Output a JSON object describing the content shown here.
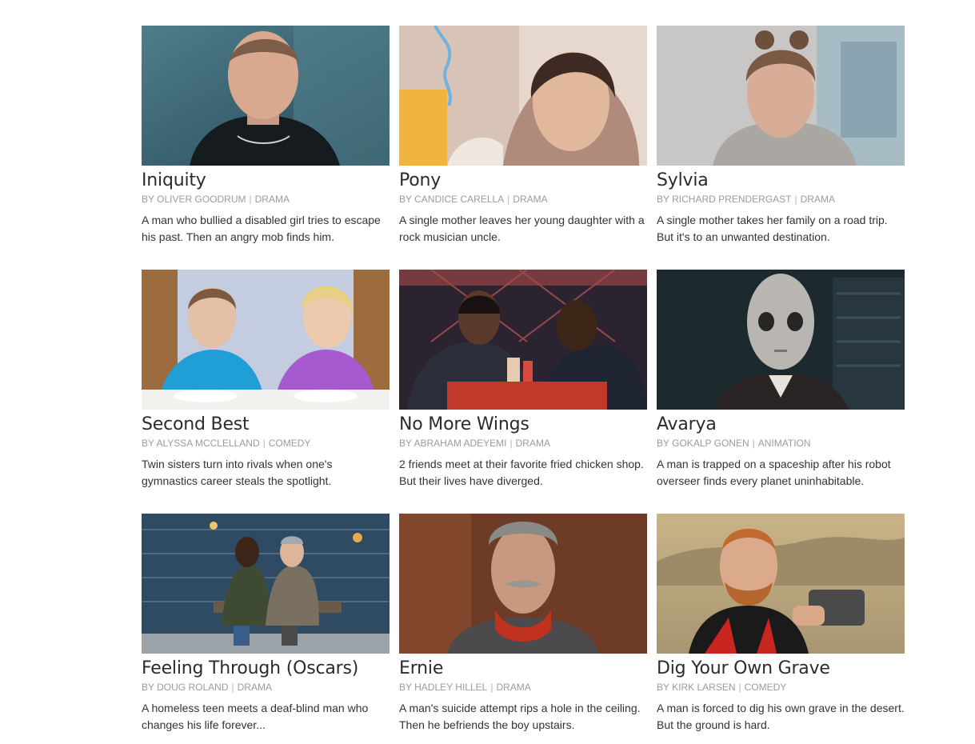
{
  "films": [
    {
      "title": "Iniquity",
      "by_prefix": "BY",
      "director": "OLIVER GOODRUM",
      "separator": "|",
      "genre": "DRAMA",
      "description": "A man who bullied a disabled girl tries to escape his past. Then an angry mob finds him."
    },
    {
      "title": "Pony",
      "by_prefix": "BY",
      "director": "CANDICE CARELLA",
      "separator": "|",
      "genre": "DRAMA",
      "description": "A single mother leaves her young daughter with a rock musician uncle."
    },
    {
      "title": "Sylvia",
      "by_prefix": "BY",
      "director": "RICHARD PRENDERGAST",
      "separator": "|",
      "genre": "DRAMA",
      "description": "A single mother takes her family on a road trip. But it's to an unwanted destination."
    },
    {
      "title": "Second Best",
      "by_prefix": "BY",
      "director": "ALYSSA MCCLELLAND",
      "separator": "|",
      "genre": "COMEDY",
      "description": "Twin sisters turn into rivals when one's gymnastics career steals the spotlight."
    },
    {
      "title": "No More Wings",
      "by_prefix": "BY",
      "director": "ABRAHAM ADEYEMI",
      "separator": "|",
      "genre": "DRAMA",
      "description": "2 friends meet at their favorite fried chicken shop. But their lives have diverged."
    },
    {
      "title": "Avarya",
      "by_prefix": "BY",
      "director": "GOKALP GONEN",
      "separator": "|",
      "genre": "ANIMATION",
      "description": "A man is trapped on a spaceship after his robot overseer finds every planet uninhabitable."
    },
    {
      "title": "Feeling Through (Oscars)",
      "by_prefix": "BY",
      "director": "DOUG ROLAND",
      "separator": "|",
      "genre": "DRAMA",
      "description": "A homeless teen meets a deaf-blind man who changes his life forever..."
    },
    {
      "title": "Ernie",
      "by_prefix": "BY",
      "director": "HADLEY HILLEL",
      "separator": "|",
      "genre": "DRAMA",
      "description": "A man's suicide attempt rips a hole in the ceiling. Then he befriends the boy upstairs."
    },
    {
      "title": "Dig Your Own Grave",
      "by_prefix": "BY",
      "director": "KIRK LARSEN",
      "separator": "|",
      "genre": "COMEDY",
      "description": "A man is forced to dig his own grave in the desert. But the ground is hard."
    }
  ]
}
